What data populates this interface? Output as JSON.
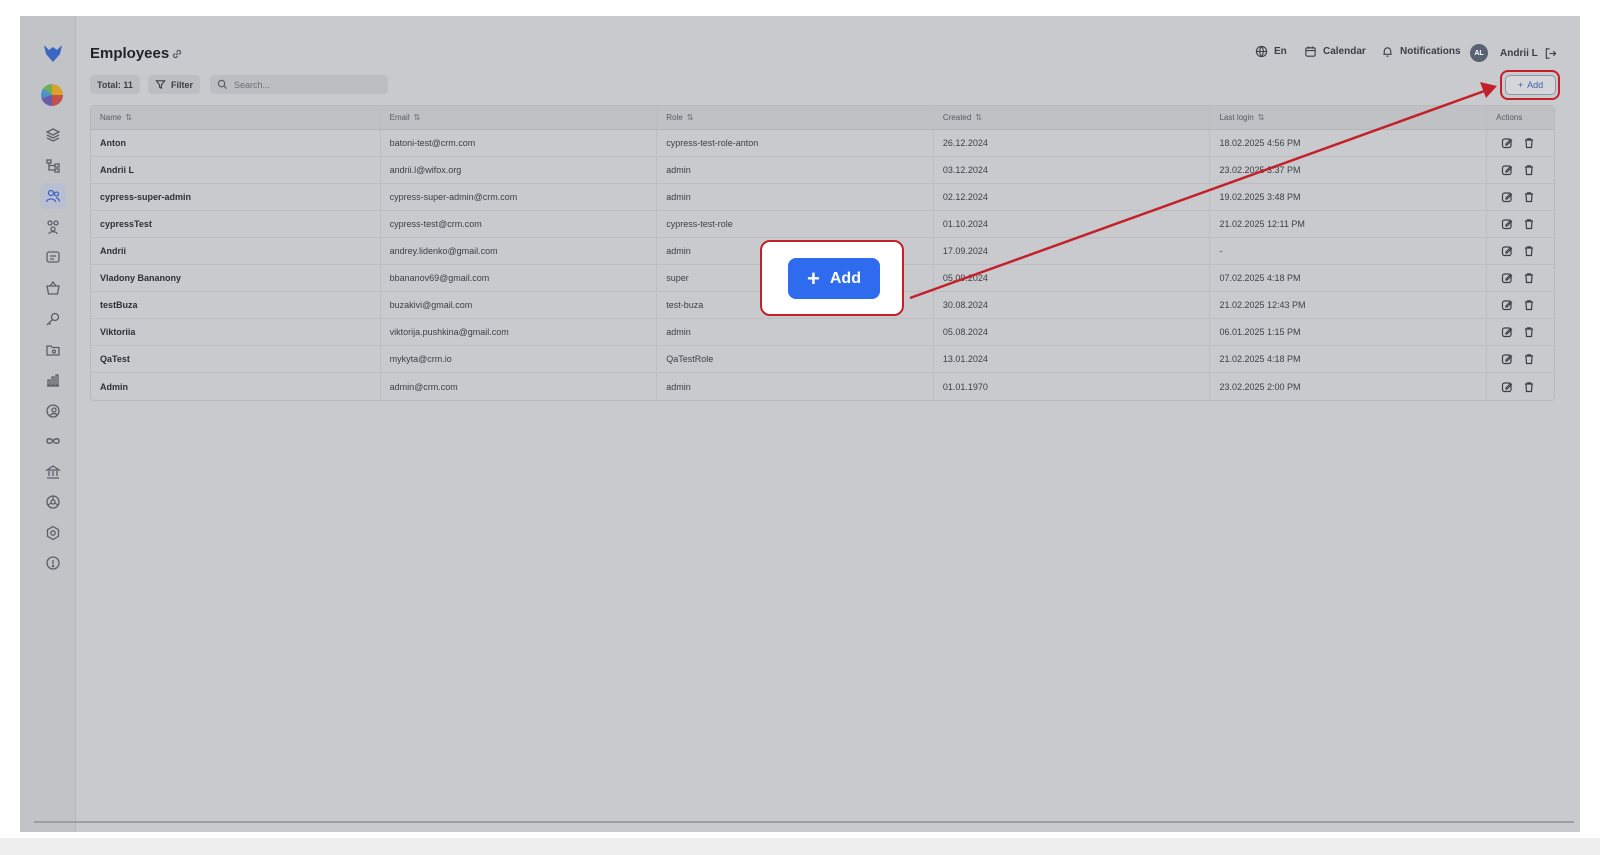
{
  "header": {
    "title": "Employees",
    "language_label": "En",
    "calendar_label": "Calendar",
    "notifications_label": "Notifications",
    "user_initials": "AL",
    "user_name": "Andrii L"
  },
  "toolbar": {
    "total_label": "Total: 11",
    "filter_label": "Filter",
    "search_placeholder": "Search...",
    "add_label": "Add"
  },
  "callout": {
    "add_label": "Add"
  },
  "table": {
    "columns": [
      "Name",
      "Email",
      "Role",
      "Created",
      "Last login",
      "Actions"
    ],
    "rows": [
      {
        "name": "Anton",
        "email": "batoni-test@crm.com",
        "role": "cypress-test-role-anton",
        "created": "26.12.2024",
        "last_login": "18.02.2025 4:56 PM"
      },
      {
        "name": "Andrii L",
        "email": "andrii.l@wifox.org",
        "role": "admin",
        "created": "03.12.2024",
        "last_login": "23.02.2025 3:37 PM"
      },
      {
        "name": "cypress-super-admin",
        "email": "cypress-super-admin@crm.com",
        "role": "admin",
        "created": "02.12.2024",
        "last_login": "19.02.2025 3:48 PM"
      },
      {
        "name": "cypressTest",
        "email": "cypress-test@crm.com",
        "role": "cypress-test-role",
        "created": "01.10.2024",
        "last_login": "21.02.2025 12:11 PM"
      },
      {
        "name": "Andrii",
        "email": "andrey.lidenko@gmail.com",
        "role": "admin",
        "created": "17.09.2024",
        "last_login": "-"
      },
      {
        "name": "Vladony Bananony",
        "email": "bbananov69@gmail.com",
        "role": "super",
        "created": "05.09.2024",
        "last_login": "07.02.2025 4:18 PM"
      },
      {
        "name": "testBuza",
        "email": "buzakivi@gmail.com",
        "role": "test-buza",
        "created": "30.08.2024",
        "last_login": "21.02.2025 12:43 PM"
      },
      {
        "name": "Viktoriia",
        "email": "viktorija.pushkina@gmail.com",
        "role": "admin",
        "created": "05.08.2024",
        "last_login": "06.01.2025 1:15 PM"
      },
      {
        "name": "QaTest",
        "email": "mykyta@crm.io",
        "role": "QaTestRole",
        "created": "13.01.2024",
        "last_login": "21.02.2025 4:18 PM"
      },
      {
        "name": "Admin",
        "email": "admin@crm.com",
        "role": "admin",
        "created": "01.01.1970",
        "last_login": "23.02.2025 2:00 PM"
      }
    ]
  },
  "colors": {
    "accent": "#2e6bef",
    "highlight": "#c4202a"
  }
}
